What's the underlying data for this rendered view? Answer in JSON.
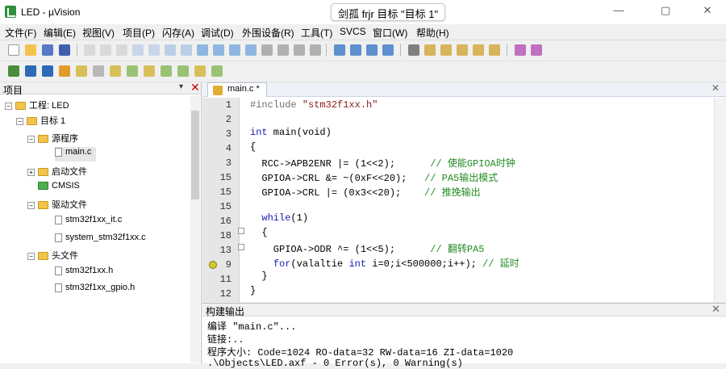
{
  "window": {
    "app_title": "LED - µVision",
    "center_title": "剑孤 frjr 目标 \"目标 1\"",
    "controls": [
      "—",
      "▢",
      "✕"
    ]
  },
  "menu": [
    "文件(F)",
    "编辑(E)",
    "视图(V)",
    "项目(P)",
    "闪存(A)",
    "调试(D)",
    "外围设备(R)",
    "工具(T)",
    "SVCS",
    "窗口(W)",
    "帮助(H)"
  ],
  "project": {
    "title": "项目",
    "pin": "▾",
    "close": "✕",
    "tree": [
      {
        "label": "工程: LED",
        "type": "folder",
        "expander": "−"
      },
      {
        "label": "目标 1",
        "type": "folder",
        "expander": "−"
      },
      {
        "label": "源程序",
        "type": "folder",
        "expander": "−"
      },
      {
        "label": "main.c",
        "type": "file",
        "selected": true
      },
      {
        "label": "启动文件",
        "type": "folder",
        "expander": "+"
      },
      {
        "label": "CMSIS",
        "type": "folder-green",
        "expander": ""
      },
      {
        "label": "驱动文件",
        "type": "folder",
        "expander": "−"
      },
      {
        "label": "stm32f1xx_it.c",
        "type": "file"
      },
      {
        "label": "system_stm32f1xx.c",
        "type": "file"
      },
      {
        "label": "头文件",
        "type": "folder",
        "expander": "−"
      },
      {
        "label": "stm32f1xx.h",
        "type": "file"
      },
      {
        "label": "stm32f1xx_gpio.h",
        "type": "file"
      }
    ]
  },
  "editor": {
    "tab_label": "main.c *",
    "close": "✕",
    "line_numbers": [
      "1",
      "2",
      "3",
      "4",
      "3",
      "15",
      "15",
      "15",
      "16",
      "18",
      "13",
      "9",
      "11",
      "12",
      "13"
    ],
    "breakpoint_line_index": 11,
    "code": {
      "l1_pp": "#include ",
      "l1_str": "\"stm32f1xx.h\"",
      "l3_kw": "int",
      "l3_rest": " main(void)",
      "l4": "{",
      "l5": "  RCC->APB2ENR |= (1<<2);",
      "l5_cm": "// 使能GPIOA时钟",
      "l6": "  GPIOA->CRL &= ~(0xF<<20);",
      "l6_cm": "// PA5输出模式",
      "l7": "  GPIOA->CRL |= (0x3<<20);",
      "l7_cm": "// 推挽输出",
      "l9_kw": "while",
      "l9_rest": "(1)",
      "l10": "  {",
      "l11": "    GPIOA->ODR ^= (1<<5);",
      "l11_cm": "// 翻转PA5",
      "l12_kw": "for",
      "l12_rest": "(valaltie ",
      "l12_kw2": "int",
      "l12_rest2": " i=0;i<500000;i++);",
      "l12_cm": "// 延时",
      "l13": "  }",
      "l14": "}"
    }
  },
  "build_output": {
    "title": "构建输出",
    "close": "✕",
    "lines": [
      "编译 \"main.c\"...",
      "链接:..",
      "程序大小: Code=1024 RO-data=32 RW-data=16 ZI-data=1020",
      ".\\Objects\\LED.axf - 0 Error(s), 0 Warning(s)"
    ]
  },
  "colors": {
    "keyword": "#1a1ab3",
    "comment": "#228b22",
    "string": "#8b1a1a",
    "gutter": "#e6e6e6",
    "close_red": "#cc0000"
  }
}
